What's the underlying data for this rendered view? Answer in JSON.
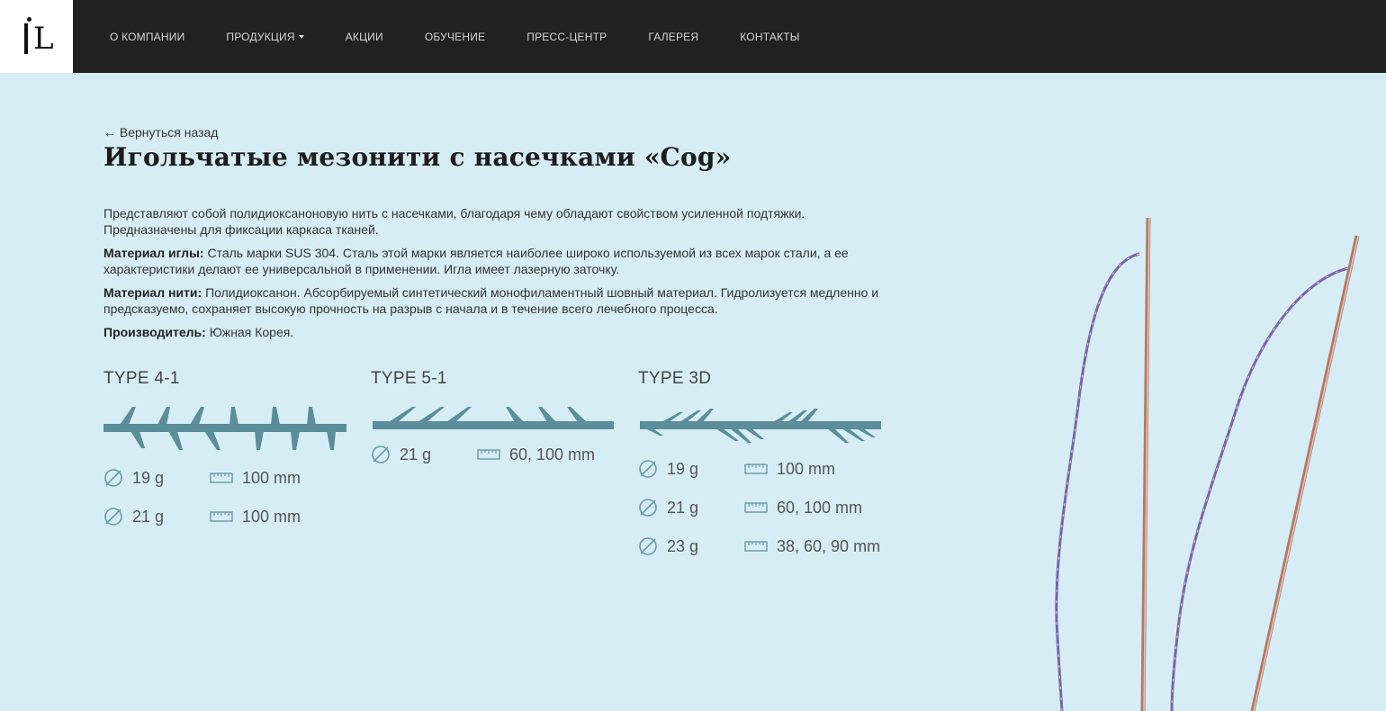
{
  "header": {
    "logo_text": "L",
    "nav": [
      {
        "label": "О КОМПАНИИ"
      },
      {
        "label": "ПРОДУКЦИЯ",
        "has_dropdown": true
      },
      {
        "label": "АКЦИИ"
      },
      {
        "label": "ОБУЧЕНИЕ"
      },
      {
        "label": "ПРЕСС-ЦЕНТР"
      },
      {
        "label": "ГАЛЕРЕЯ"
      },
      {
        "label": "КОНТАКТЫ"
      }
    ]
  },
  "page": {
    "back_link": "← Вернуться назад",
    "title": "Игольчатые мезонити с насечками «Cog»",
    "intro": "Представляют собой полидиоксаноновую нить с насечками, благодаря чему обладают свойством усиленной подтяжки. Предназначены для фиксации каркаса тканей.",
    "needle_material_label": "Материал иглы:",
    "needle_material": " Сталь марки SUS 304. Сталь этой марки является наиболее широко используемой из всех марок стали, а ее характеристики делают ее универсальной в применении. Игла имеет лазерную заточку.",
    "thread_material_label": "Материал нити:",
    "thread_material": " Полидиоксанон. Абсорбируемый синтетический монофиламентный шовный материал. Гидролизуется медленно и предсказуемо, сохраняет высокую прочность на разрыв с начала и в течение всего лечебного процесса.",
    "manufacturer_label": "Производитель:",
    "manufacturer": " Южная Корея."
  },
  "types": [
    {
      "name": "TYPE 4-1",
      "specs": [
        {
          "gauge": "19 g",
          "length": "100 mm"
        },
        {
          "gauge": "21 g",
          "length": "100 mm"
        }
      ]
    },
    {
      "name": "TYPE 5-1",
      "specs": [
        {
          "gauge": "21 g",
          "length": "60, 100 mm"
        }
      ]
    },
    {
      "name": "TYPE 3D",
      "specs": [
        {
          "gauge": "19 g",
          "length": "100 mm"
        },
        {
          "gauge": "21 g",
          "length": "60, 100 mm"
        },
        {
          "gauge": "23 g",
          "length": "38, 60, 90 mm"
        }
      ]
    }
  ],
  "colors": {
    "background": "#d6edf5",
    "header": "#212121",
    "thread_diagram": "#5b8d9b",
    "icon": "#6a9aa8"
  },
  "icons": {
    "gauge": "diameter-icon",
    "length": "ruler-icon"
  }
}
